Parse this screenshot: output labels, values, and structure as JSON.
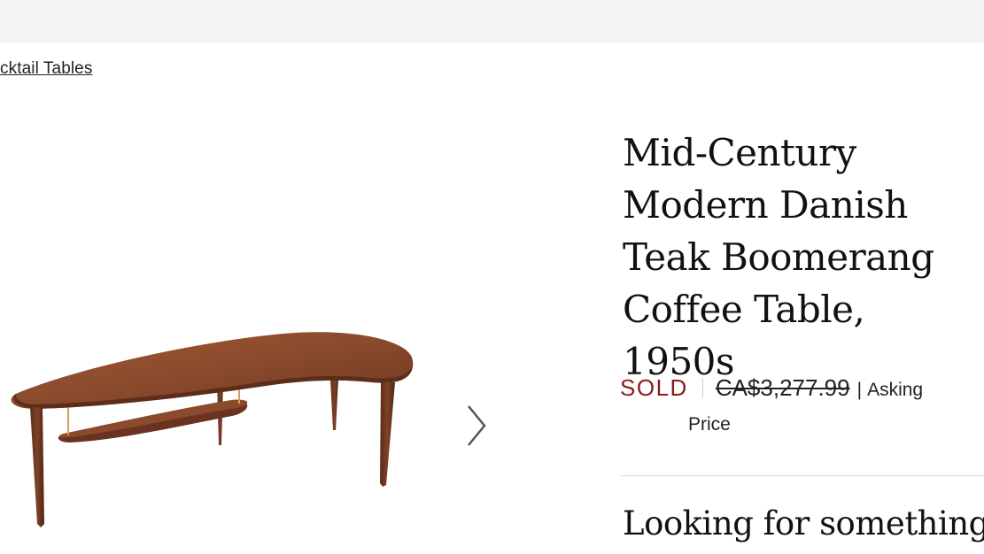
{
  "breadcrumb": {
    "label": "cktail Tables"
  },
  "product": {
    "title_lines": [
      "Mid-Century",
      "Modern Danish",
      "Teak Boomerang",
      "Coffee Table, 1950s"
    ],
    "status": "SOLD",
    "original_price": "CA$3,277.99",
    "price_note_line1": "Asking",
    "price_note_line2": "Price"
  },
  "gallery": {
    "next_icon": "chevron-right-icon",
    "image_alt": "teak boomerang coffee table"
  },
  "section": {
    "heading": "Looking for something"
  },
  "colors": {
    "sold": "#8f1a1a",
    "topbar": "#f3f3f3",
    "wood": "#8a4a2c"
  }
}
